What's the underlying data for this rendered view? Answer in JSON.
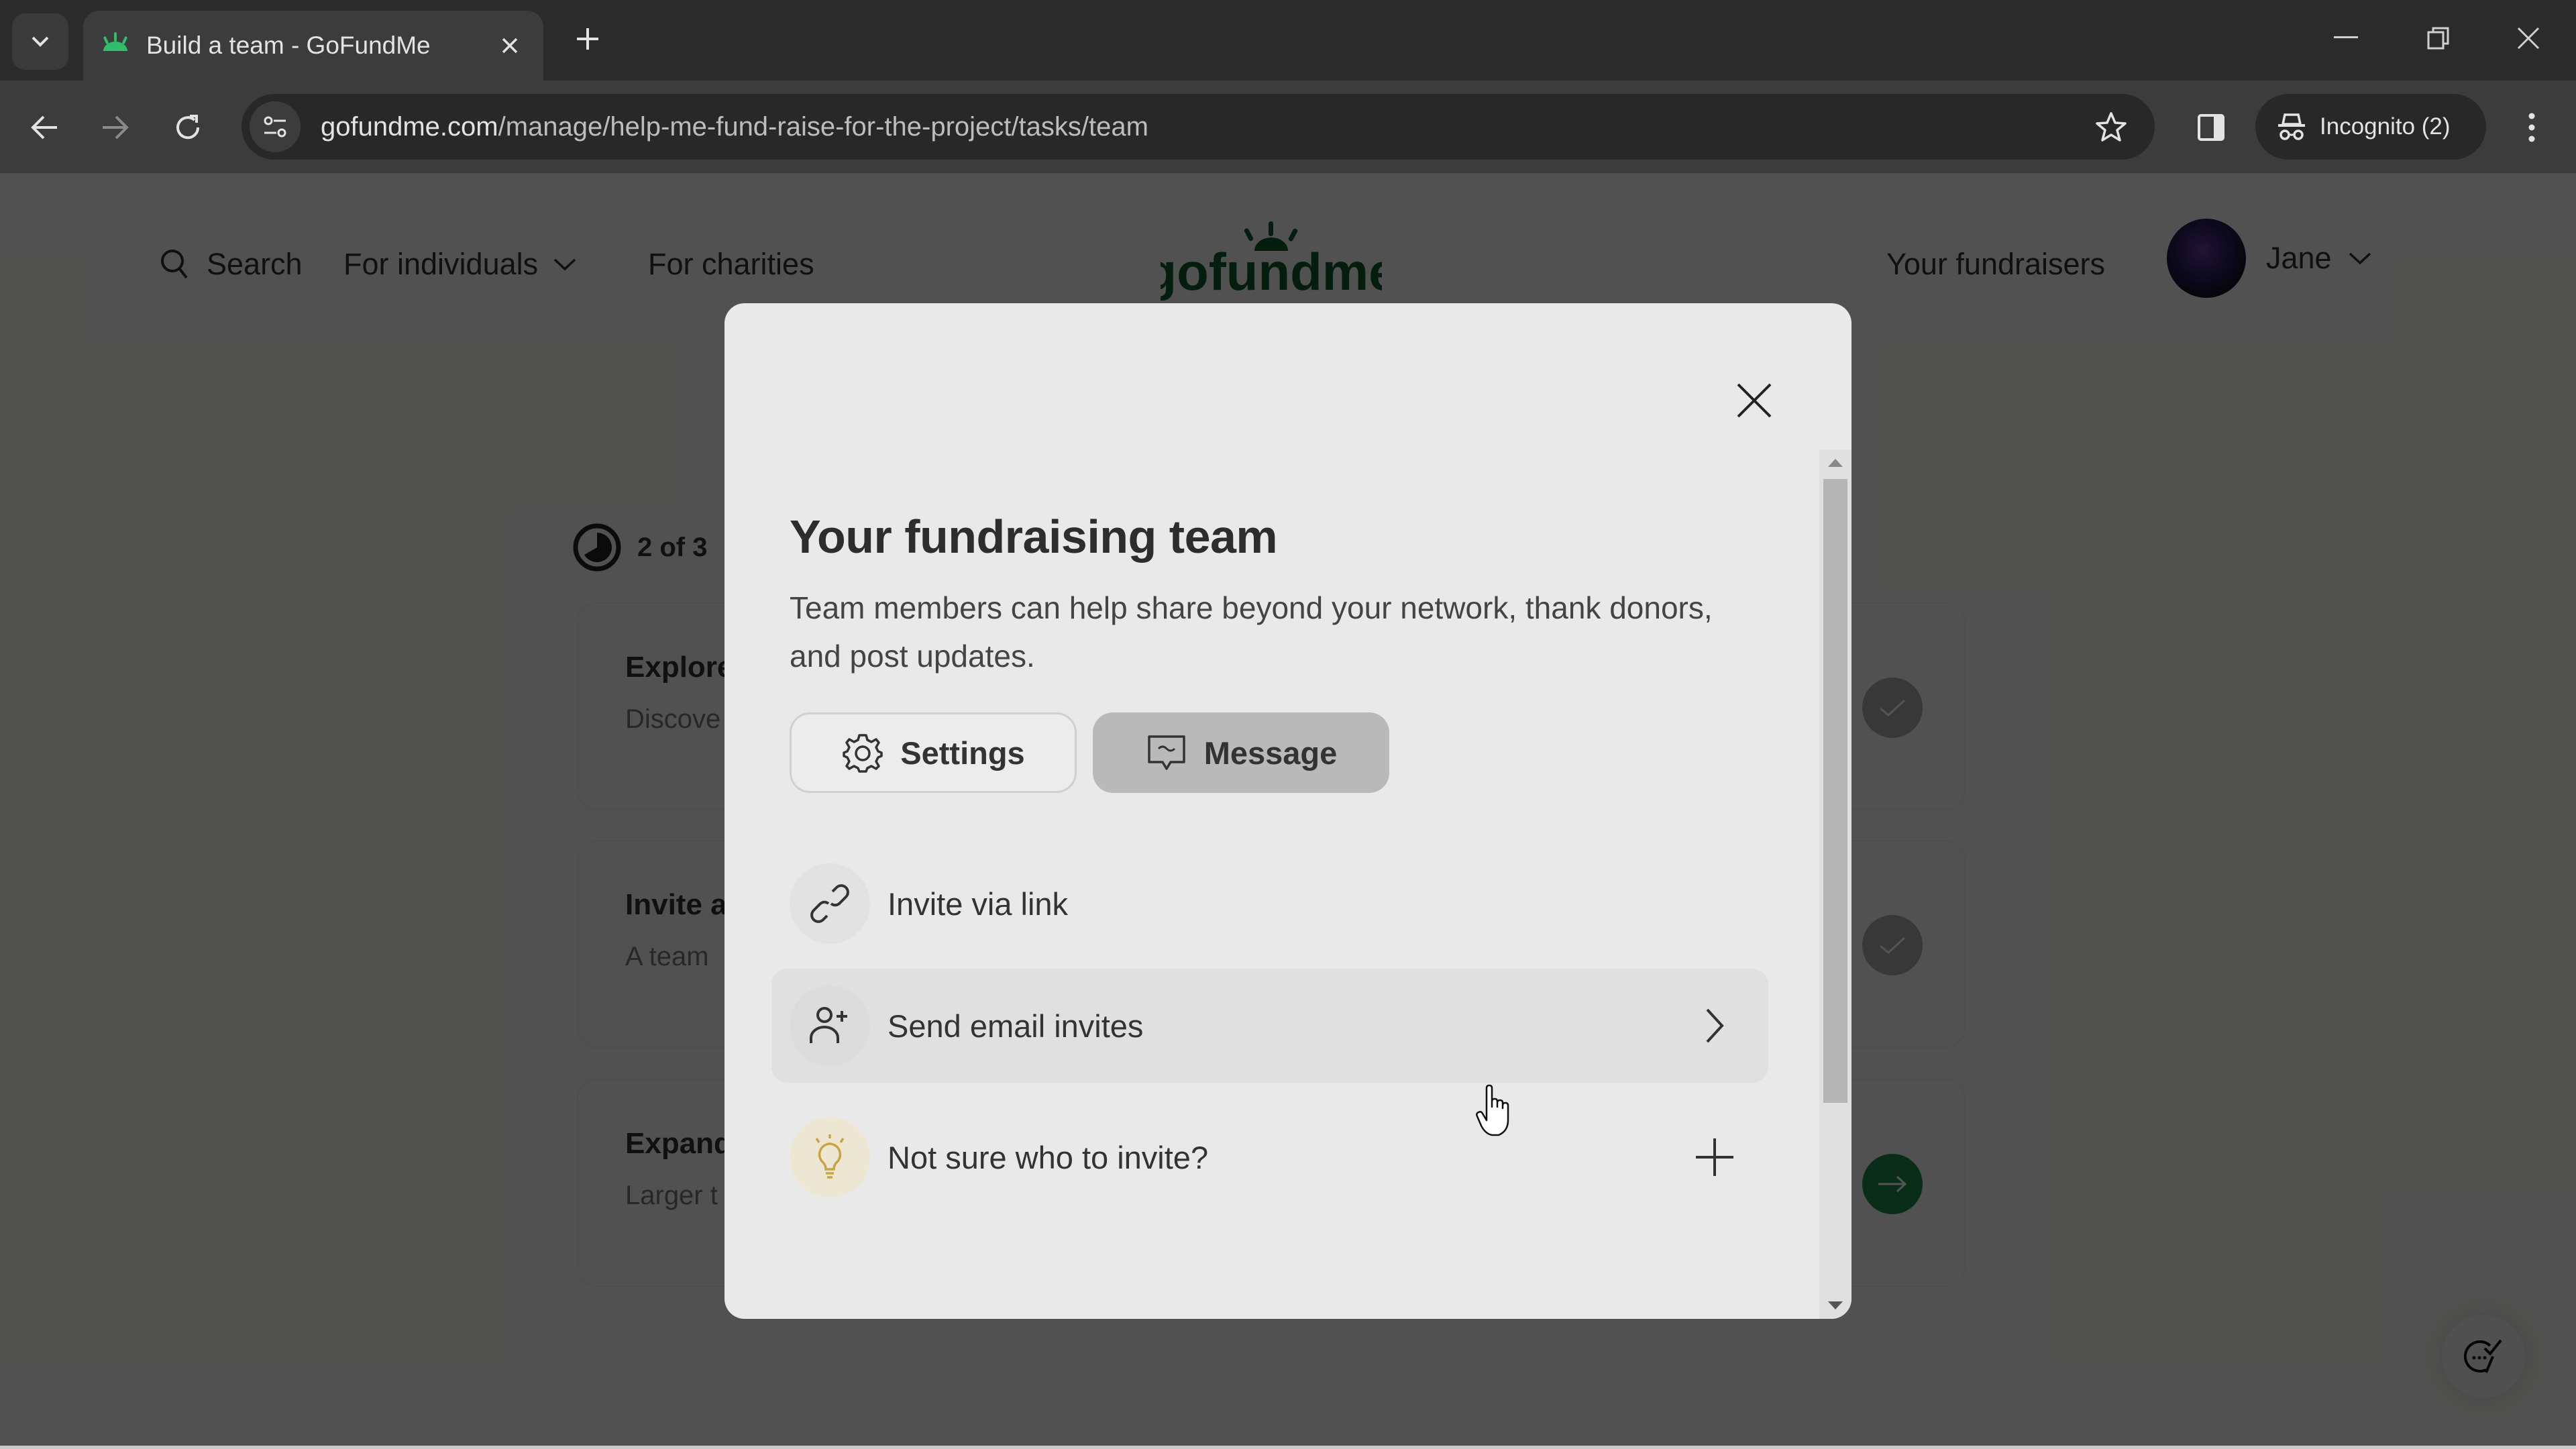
{
  "browser": {
    "tab": {
      "title": "Build a team - GoFundMe",
      "favicon": "gofundme-sprout-icon"
    },
    "url": {
      "host": "gofundme.com",
      "path": "/manage/help-me-fund-raise-for-the-project/tasks/team"
    },
    "incognito_label": "Incognito (2)",
    "icons": [
      "tab-search-icon",
      "close-icon",
      "plus-icon",
      "minimize-icon",
      "restore-icon",
      "close-window-icon",
      "back-arrow-icon",
      "forward-arrow-icon",
      "reload-icon",
      "site-info-icon",
      "star-icon",
      "side-panel-icon",
      "incognito-icon",
      "kebab-menu-icon"
    ]
  },
  "site_header": {
    "search_label": "Search",
    "for_individuals_label": "For individuals",
    "for_charities_label": "For charities",
    "logo_text": "gofundme",
    "your_fundraisers_label": "Your fundraisers",
    "user_name": "Jane"
  },
  "tasks": {
    "progress_label": "2 of 3",
    "progress_completed": 2,
    "progress_total": 3,
    "items": [
      {
        "title": "Explore",
        "desc": "Discove",
        "status": "completed"
      },
      {
        "title": "Invite a",
        "desc": "A team",
        "status": "completed"
      },
      {
        "title": "Expand",
        "desc": "Larger t",
        "status": "next"
      }
    ]
  },
  "modal": {
    "title": "Your fundraising team",
    "description": "Team members can help share beyond your network, thank donors, and post updates.",
    "settings_label": "Settings",
    "message_label": "Message",
    "options": [
      {
        "label": "Invite via link",
        "icon": "link-icon",
        "trail": ""
      },
      {
        "label": "Send email invites",
        "icon": "add-person-icon",
        "trail": "chevron-right-icon"
      },
      {
        "label": "Not sure who to invite?",
        "icon": "lightbulb-icon",
        "trail": "plus-icon"
      }
    ]
  },
  "colors": {
    "brand_green": "#0b5c2e",
    "bulb_gold": "#c9a441",
    "modal_bg": "#e9e9e9",
    "message_button_bg": "#b9b9b9"
  }
}
